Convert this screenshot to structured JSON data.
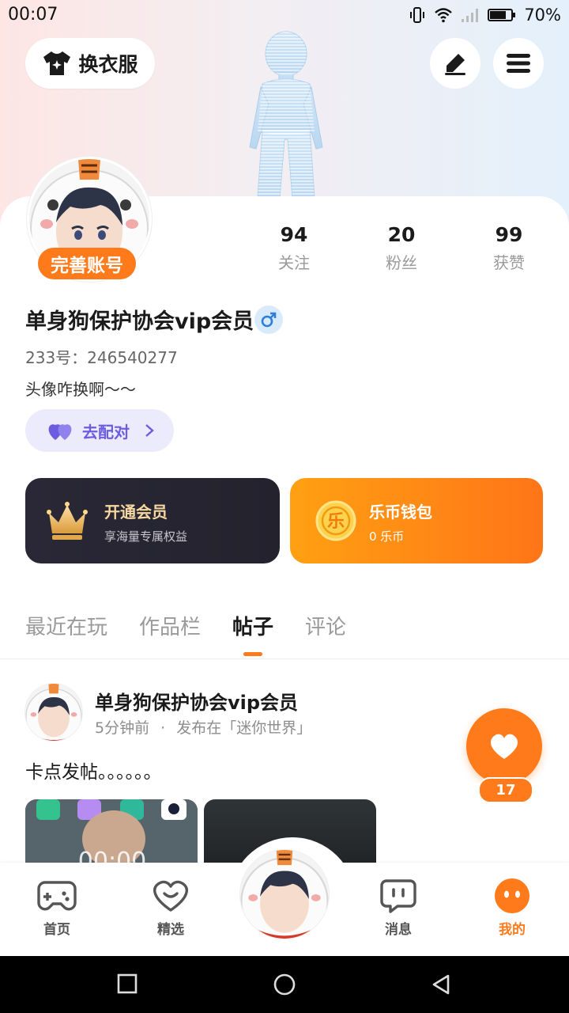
{
  "status_bar": {
    "time": "00:07",
    "battery": "70%"
  },
  "header": {
    "outfit_label": "换衣服",
    "outfit_icon": "tshirt-icon",
    "edit_icon": "pen-icon",
    "menu_icon": "hamburger-icon"
  },
  "profile": {
    "complete_badge": "完善账号",
    "username": "单身狗保护协会vip会员",
    "gender_icon": "male-icon",
    "uid": "233号：246540277",
    "bio": "头像咋换啊～～",
    "match_label": "去配对"
  },
  "stats": [
    {
      "num": "94",
      "label": "关注"
    },
    {
      "num": "20",
      "label": "粉丝"
    },
    {
      "num": "99",
      "label": "获赞"
    }
  ],
  "vip": {
    "title": "开通会员",
    "subtitle": "享海量专属权益"
  },
  "wallet": {
    "title": "乐币钱包",
    "subtitle": "0 乐币",
    "coin_glyph": "乐"
  },
  "tabs": [
    "最近在玩",
    "作品栏",
    "帖子",
    "评论"
  ],
  "active_tab": "帖子",
  "post": {
    "author": "单身狗保护协会vip会员",
    "time": "5分钟前",
    "separator": "·",
    "location": "发布在「迷你世界」",
    "text": "卡点发帖。。。。。。",
    "likes": "17"
  },
  "nav": [
    {
      "label": "首页"
    },
    {
      "label": "精选"
    },
    {
      "label": "消息"
    },
    {
      "label": "我的"
    }
  ],
  "colors": {
    "accent": "#ff7a1a",
    "match": "#6d5ce0",
    "vip_text": "#f7d8a1"
  }
}
